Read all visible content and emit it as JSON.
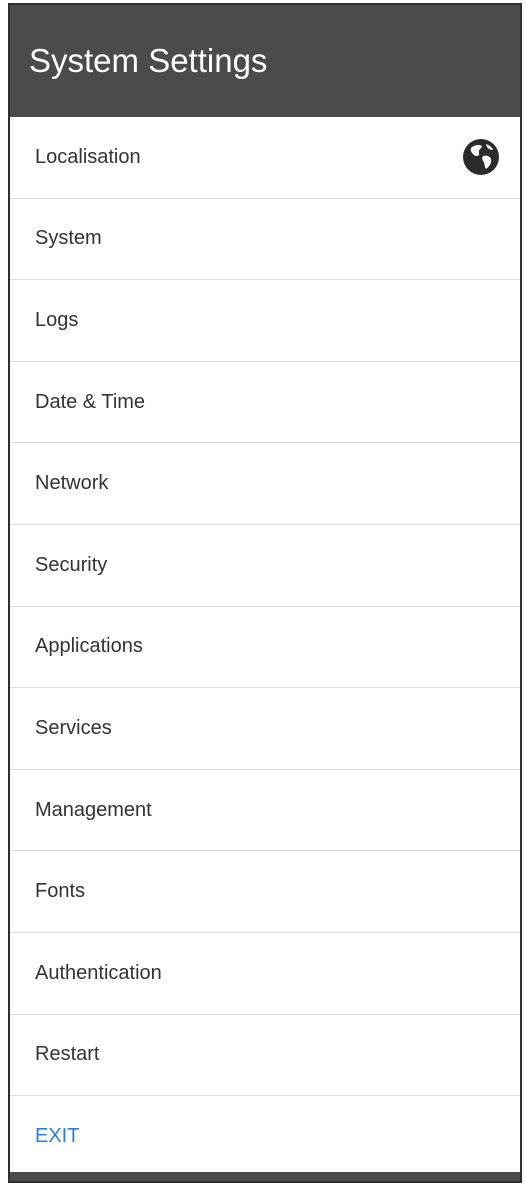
{
  "header": {
    "title": "System Settings"
  },
  "menu": {
    "items": [
      {
        "label": "Localisation",
        "icon": "globe-icon"
      },
      {
        "label": "System"
      },
      {
        "label": "Logs"
      },
      {
        "label": "Date & Time"
      },
      {
        "label": "Network"
      },
      {
        "label": "Security"
      },
      {
        "label": "Applications"
      },
      {
        "label": "Services"
      },
      {
        "label": "Management"
      },
      {
        "label": "Fonts"
      },
      {
        "label": "Authentication"
      },
      {
        "label": "Restart"
      }
    ],
    "exit_label": "EXIT"
  },
  "colors": {
    "header_bg": "#4b4b4b",
    "exit_link": "#2a7de1"
  }
}
